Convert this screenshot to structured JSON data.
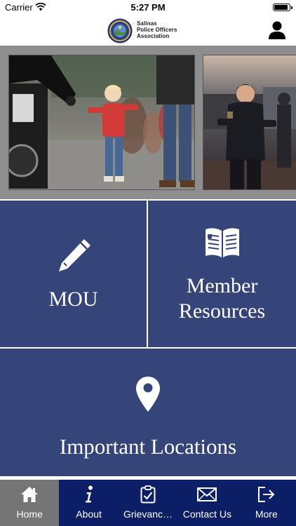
{
  "status_bar": {
    "carrier": "Carrier",
    "time": "5:27 PM",
    "battery_level": 0.95
  },
  "header": {
    "logo_line1": "Salinas",
    "logo_line2": "Police Officers",
    "logo_line3": "Association",
    "profile_icon": "user-icon"
  },
  "photos": [
    {
      "description_icon": "photo-officer-child"
    },
    {
      "description_icon": "photo-officer-laughing"
    }
  ],
  "tiles": {
    "mou": {
      "label": "MOU",
      "icon": "pen-icon"
    },
    "member_resources": {
      "label_line1": "Member",
      "label_line2": "Resources",
      "icon": "book-icon"
    },
    "important_locations": {
      "label": "Important Locations",
      "icon": "map-pin-icon"
    }
  },
  "tab_bar": {
    "tabs": [
      {
        "label": "Home",
        "icon": "home-icon",
        "active": true
      },
      {
        "label": "About",
        "icon": "info-icon",
        "active": false
      },
      {
        "label": "Grievanc…",
        "icon": "clipboard-icon",
        "active": false
      },
      {
        "label": "Contact Us",
        "icon": "envelope-icon",
        "active": false
      },
      {
        "label": "More",
        "icon": "logout-icon",
        "active": false
      }
    ]
  },
  "colors": {
    "tile_blue": "#35457a",
    "tab_bar_navy": "#0b1e66",
    "tab_active_gray": "#757575",
    "photo_strip_gray": "#8e8e8e"
  }
}
